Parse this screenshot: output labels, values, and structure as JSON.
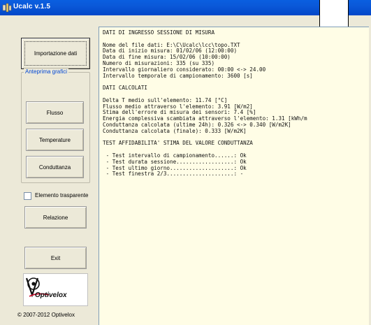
{
  "window": {
    "title": "Ucalc v.1.5",
    "icon": "ucalc-app-icon"
  },
  "sidebar": {
    "import_button": "Importazione dati",
    "preview_group_label": "Anteprima grafici",
    "flux_button": "Flusso",
    "temperature_button": "Temperature",
    "conductance_button": "Conduttanza",
    "transparent_checkbox": {
      "label": "Elemento trasparente",
      "checked": false
    },
    "report_button": "Relazione",
    "exit_button": "Exit",
    "logo_text": "Optivelox",
    "copyright": "© 2007-2012 Optivelox"
  },
  "report": {
    "lines": [
      "DATI DI INGRESSO SESSIONE DI MISURA",
      "",
      "Nome del file dati: E:\\C\\Ucalc\\lcc\\topo.TXT",
      "Data di inizio misura: 01/02/06 (12:00:00)",
      "Data di fine misura: 15/02/06 (10:00:00)",
      "Numero di misurazioni: 335 (su 335)",
      "Intervallo giornaliero considerato: 00:00 <-> 24.00",
      "Intervallo temporale di campionamento: 3600 [s]",
      "",
      "DATI CALCOLATI",
      "",
      "Delta T medio sull'elemento: 11.74 [°C]",
      "Flusso medio attraverso l'elemento: 3.91 [W/m2]",
      "Stima dell'errore di misura dei sensori: 7.4 [%]",
      "Energia complessiva scambiata attraverso l'elemento: 1.31 [kWh/m",
      "Conduttanza calcolata (ultime 24h): 0.326 <-> 0.340 [W/m2K]",
      "Conduttanza calcolata (finale): 0.333 [W/m2K]",
      "",
      "TEST AFFIDABILITA' STIMA DEL VALORE CONDUTTANZA",
      "",
      " - Test intervallo di campionamento......: Ok",
      " - Test durata sessione..................: Ok",
      " - Test ultimo giorno....................: Ok",
      " - Test finestra 2/3.....................: -"
    ]
  },
  "colors": {
    "titlebar": "#0a58d8",
    "panel_bg": "#ece9d8",
    "report_bg": "#fffde6",
    "group_label": "#0046d5",
    "logo_red": "#c8102e"
  }
}
